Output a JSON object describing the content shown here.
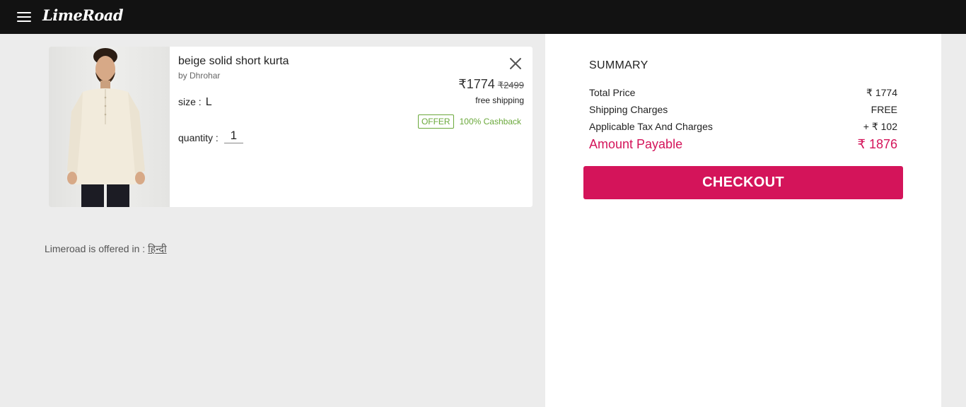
{
  "header": {
    "logo_text": "LimeRoad",
    "menu_icon": "hamburger-menu-icon",
    "bg_color": "#121212"
  },
  "cart": {
    "item": {
      "title": "beige solid short kurta",
      "brand": "by Dhrohar",
      "size_label": "size :",
      "size_value": "L",
      "quantity_label": "quantity :",
      "quantity_value": "1",
      "price": "₹1774",
      "mrp": "₹2499",
      "shipping": "free shipping",
      "offer_badge": "OFFER",
      "offer_text": "100% Cashback"
    }
  },
  "language": {
    "text": "Limeroad is offered in :",
    "link": "हिन्दी"
  },
  "summary": {
    "title": "SUMMARY",
    "rows": [
      {
        "label": "Total Price",
        "value": "₹ 1774"
      },
      {
        "label": "Shipping Charges",
        "value": "FREE"
      },
      {
        "label": "Applicable Tax And Charges",
        "value": "+ ₹ 102"
      }
    ],
    "total_label": "Amount Payable",
    "total_value": "₹ 1876",
    "checkout_label": "CHECKOUT",
    "accent_color": "#d4145a"
  }
}
